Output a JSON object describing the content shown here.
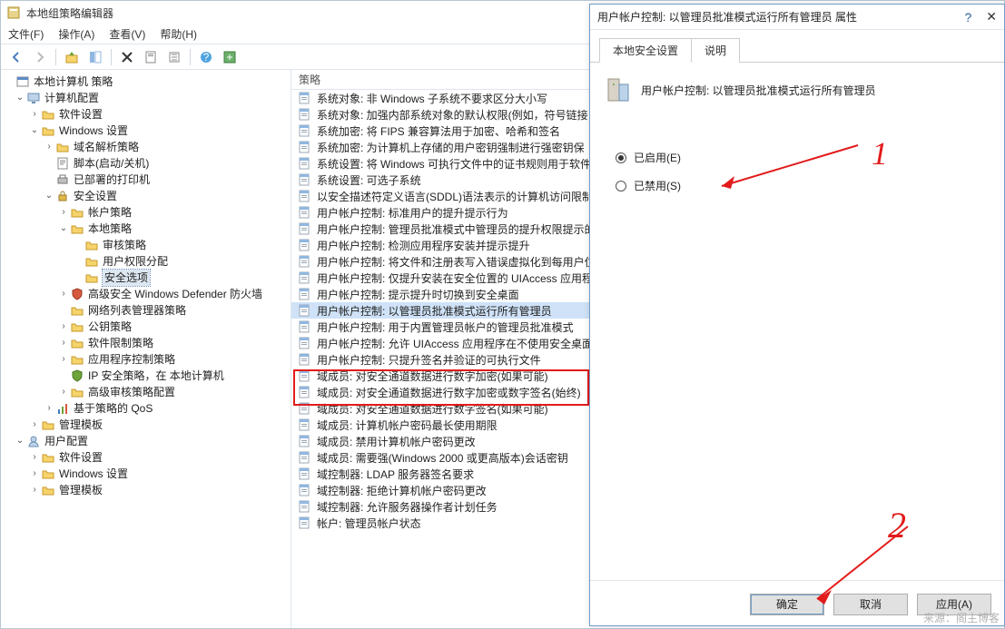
{
  "mmc": {
    "title": "本地组策略编辑器",
    "menus": {
      "file": "文件(F)",
      "action": "操作(A)",
      "view": "查看(V)",
      "help": "帮助(H)"
    },
    "tree": {
      "root": "本地计算机 策略",
      "computer_cfg": "计算机配置",
      "soft_settings": "软件设置",
      "win_settings": "Windows 设置",
      "name_res": "域名解析策略",
      "scripts": "脚本(启动/关机)",
      "printers": "已部署的打印机",
      "sec_settings": "安全设置",
      "account_policy": "帐户策略",
      "local_policy": "本地策略",
      "audit_policy": "审核策略",
      "user_rights": "用户权限分配",
      "sec_options": "安全选项",
      "defender": "高级安全 Windows Defender 防火墙",
      "netlist": "网络列表管理器策略",
      "pubkey": "公钥策略",
      "soft_restrict": "软件限制策略",
      "app_ctrl": "应用程序控制策略",
      "ipsec": "IP 安全策略，在 本地计算机",
      "adv_audit": "高级审核策略配置",
      "qos": "基于策略的 QoS",
      "admin_templates": "管理模板",
      "user_cfg": "用户配置",
      "user_soft": "软件设置",
      "user_win": "Windows 设置",
      "user_admin": "管理模板"
    },
    "list_header": "策略",
    "policies": [
      "系统对象: 非 Windows 子系统不要求区分大小写",
      "系统对象: 加强内部系统对象的默认权限(例如，符号链接",
      "系统加密: 将 FIPS 兼容算法用于加密、哈希和签名",
      "系统加密: 为计算机上存储的用户密钥强制进行强密钥保",
      "系统设置: 将 Windows 可执行文件中的证书规则用于软件",
      "系统设置: 可选子系统",
      "以安全描述符定义语言(SDDL)语法表示的计算机访问限制",
      "用户帐户控制: 标准用户的提升提示行为",
      "用户帐户控制: 管理员批准模式中管理员的提升权限提示的",
      "用户帐户控制: 检测应用程序安装并提示提升",
      "用户帐户控制: 将文件和注册表写入错误虚拟化到每用户位",
      "用户帐户控制: 仅提升安装在安全位置的 UIAccess 应用程",
      "用户帐户控制: 提示提升时切换到安全桌面",
      "用户帐户控制: 以管理员批准模式运行所有管理员",
      "用户帐户控制: 用于内置管理员帐户的管理员批准模式",
      "用户帐户控制: 允许 UIAccess 应用程序在不使用安全桌面",
      "用户帐户控制: 只提升签名并验证的可执行文件",
      "域成员: 对安全通道数据进行数字加密(如果可能)",
      "域成员: 对安全通道数据进行数字加密或数字签名(始终)",
      "域成员: 对安全通道数据进行数字签名(如果可能)",
      "域成员: 计算机帐户密码最长使用期限",
      "域成员: 禁用计算机帐户密码更改",
      "域成员: 需要强(Windows 2000 或更高版本)会话密钥",
      "域控制器: LDAP 服务器签名要求",
      "域控制器: 拒绝计算机帐户密码更改",
      "域控制器: 允许服务器操作者计划任务",
      "帐户: 管理员帐户状态"
    ]
  },
  "dlg": {
    "title": "用户帐户控制: 以管理员批准模式运行所有管理员 属性",
    "tabs": {
      "local_sec": "本地安全设置",
      "explain": "说明"
    },
    "heading": "用户帐户控制: 以管理员批准模式运行所有管理员",
    "radio_enabled": "已启用(E)",
    "radio_disabled": "已禁用(S)",
    "ok": "确定",
    "cancel": "取消",
    "apply": "应用(A)"
  },
  "ann": {
    "one": "1",
    "two": "2"
  },
  "watermark": "来源：阁主博客"
}
